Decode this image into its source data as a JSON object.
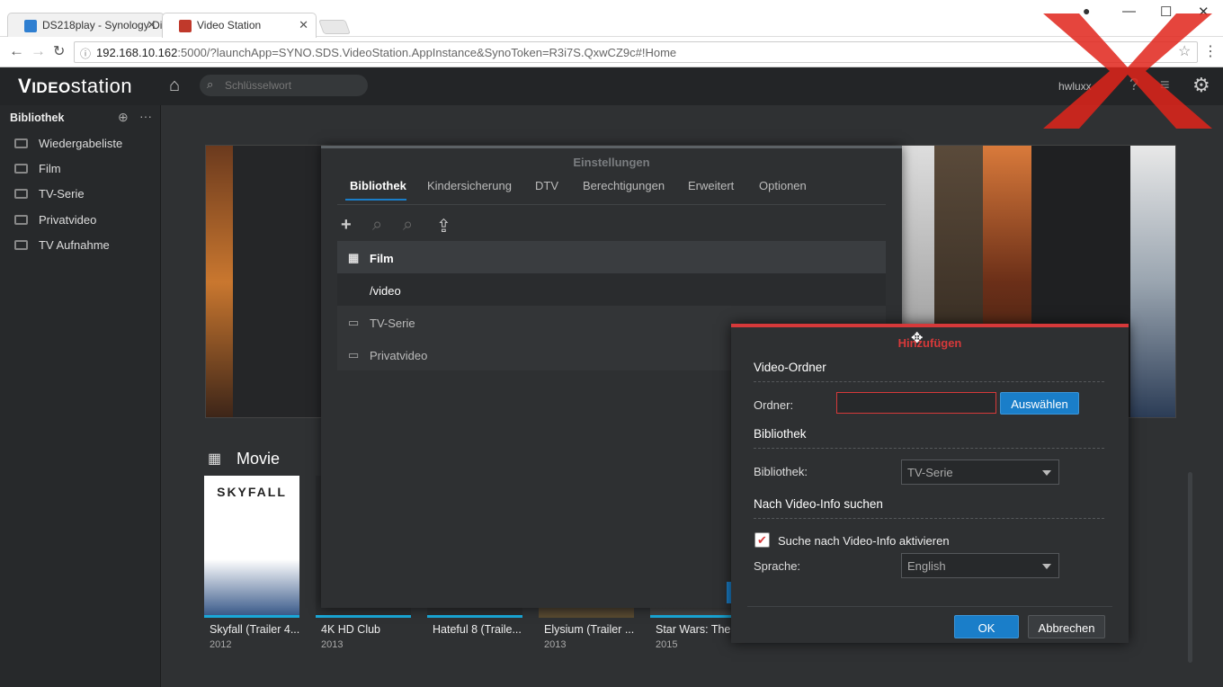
{
  "browser": {
    "tabs": [
      {
        "title": "DS218play - Synology Di"
      },
      {
        "title": "Video Station"
      }
    ],
    "url_host": "192.168.10.162",
    "url_rest": ":5000/?launchApp=SYNO.SDS.VideoStation.AppInstance&SynoToken=R3i7S.QxwCZ9c#!Home"
  },
  "app": {
    "logo_a": "V",
    "logo_b": "IDEO",
    "logo_c": "station",
    "search_placeholder": "Schlüsselwort",
    "user": "hwluxx"
  },
  "sidebar": {
    "title": "Bibliothek",
    "items": [
      {
        "label": "Wiedergabeliste"
      },
      {
        "label": "Film"
      },
      {
        "label": "TV-Serie"
      },
      {
        "label": "Privatvideo"
      },
      {
        "label": "TV Aufnahme"
      }
    ]
  },
  "main": {
    "section_title": "Movie",
    "cards": [
      {
        "title": "Skyfall (Trailer 4...",
        "year": "2012"
      },
      {
        "title": "4K HD Club",
        "year": "2013"
      },
      {
        "title": "Hateful 8 (Traile...",
        "year": ""
      },
      {
        "title": "Elysium (Trailer ...",
        "year": "2013"
      },
      {
        "title": "Star Wars: The",
        "year": "2015"
      }
    ],
    "poster_text": "SKYFALL"
  },
  "settings": {
    "title": "Einstellungen",
    "tabs": [
      "Bibliothek",
      "Kindersicherung",
      "DTV",
      "Berechtigungen",
      "Erweitert",
      "Optionen"
    ],
    "libraries": [
      {
        "label": "Film"
      },
      {
        "label": "/video"
      },
      {
        "label": "TV-Serie"
      },
      {
        "label": "Privatvideo"
      }
    ]
  },
  "add_dialog": {
    "title": "Hinzufügen",
    "section_folder": "Video-Ordner",
    "folder_label": "Ordner:",
    "folder_value": "",
    "select_button": "Auswählen",
    "section_library": "Bibliothek",
    "library_label": "Bibliothek:",
    "library_value": "TV-Serie",
    "section_search": "Nach Video-Info suchen",
    "checkbox_label": "Suche nach Video-Info aktivieren",
    "checkbox_checked": true,
    "language_label": "Sprache:",
    "language_value": "English",
    "ok": "OK",
    "cancel": "Abbrechen"
  },
  "colors": {
    "accent": "#1a7ec9",
    "danger": "#d6393a"
  }
}
